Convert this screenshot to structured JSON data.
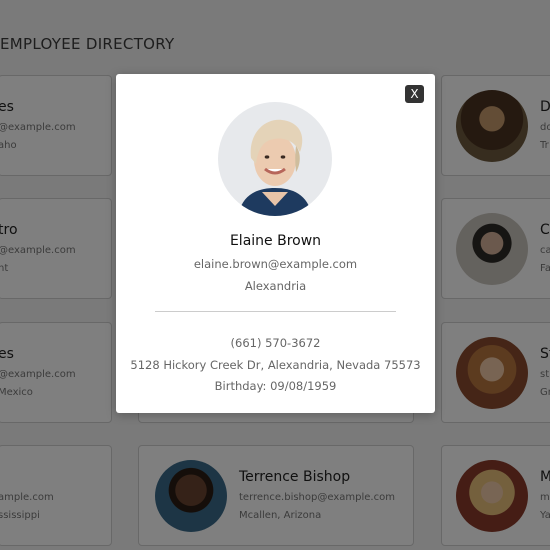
{
  "page": {
    "title": "EMPLOYEE DIRECTORY"
  },
  "cards": [
    {
      "name": "es",
      "email": "@example.com",
      "location": "aho"
    },
    {
      "name": "D",
      "email": "do",
      "location": "Tr"
    },
    {
      "name": "tro",
      "email": "@example.com",
      "location": "nt"
    },
    {
      "name": "C",
      "email": "ca",
      "location": "Fa"
    },
    {
      "name": "es",
      "email": "@example.com",
      "location": "Mexico"
    },
    {
      "name": "St",
      "email": "st",
      "location": "Gr"
    },
    {
      "name": "",
      "email": "ample.com",
      "location": "ssissippi"
    },
    {
      "name": "Terrence Bishop",
      "email": "terrence.bishop@example.com",
      "location": "Mcallen, Arizona"
    },
    {
      "name": "M",
      "email": "m",
      "location": "Ya"
    }
  ],
  "modal": {
    "close_label": "X",
    "name": "Elaine Brown",
    "email": "elaine.brown@example.com",
    "city": "Alexandria",
    "phone": "(661) 570-3672",
    "address": "5128 Hickory Creek Dr, Alexandria, Nevada 75573",
    "birthday": "Birthday: 09/08/1959"
  }
}
